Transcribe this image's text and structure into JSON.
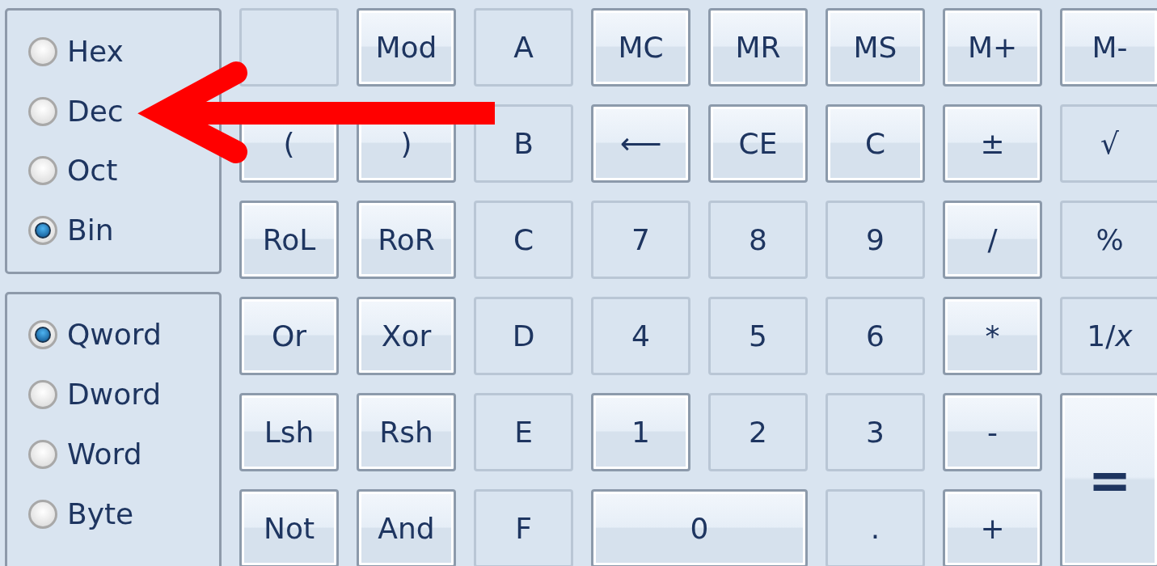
{
  "radix": [
    {
      "label": "Hex",
      "selected": false
    },
    {
      "label": "Dec",
      "selected": false
    },
    {
      "label": "Oct",
      "selected": false
    },
    {
      "label": "Bin",
      "selected": true
    }
  ],
  "word_size": [
    {
      "label": "Qword",
      "selected": true
    },
    {
      "label": "Dword",
      "selected": false
    },
    {
      "label": "Word",
      "selected": false
    },
    {
      "label": "Byte",
      "selected": false
    }
  ],
  "keys": [
    {
      "kind": "blank",
      "disabled": true
    },
    {
      "kind": "normal",
      "label": "Mod",
      "disabled": false
    },
    {
      "kind": "normal",
      "label": "A",
      "disabled": true
    },
    {
      "kind": "normal",
      "label": "MC",
      "disabled": false
    },
    {
      "kind": "normal",
      "label": "MR",
      "disabled": false
    },
    {
      "kind": "normal",
      "label": "MS",
      "disabled": false
    },
    {
      "kind": "normal",
      "label": "M+",
      "disabled": false
    },
    {
      "kind": "normal",
      "label": "M-",
      "disabled": false
    },
    {
      "kind": "normal",
      "label": "(",
      "disabled": false
    },
    {
      "kind": "normal",
      "label": ")",
      "disabled": false
    },
    {
      "kind": "normal",
      "label": "B",
      "disabled": true
    },
    {
      "kind": "normal",
      "label": "⟵",
      "disabled": false
    },
    {
      "kind": "normal",
      "label": "CE",
      "disabled": false
    },
    {
      "kind": "normal",
      "label": "C",
      "disabled": false
    },
    {
      "kind": "normal",
      "label": "±",
      "disabled": false
    },
    {
      "kind": "normal",
      "label": "√",
      "disabled": true
    },
    {
      "kind": "normal",
      "label": "RoL",
      "disabled": false
    },
    {
      "kind": "normal",
      "label": "RoR",
      "disabled": false
    },
    {
      "kind": "normal",
      "label": "C",
      "disabled": true
    },
    {
      "kind": "normal",
      "label": "7",
      "disabled": true
    },
    {
      "kind": "normal",
      "label": "8",
      "disabled": true
    },
    {
      "kind": "normal",
      "label": "9",
      "disabled": true
    },
    {
      "kind": "normal",
      "label": "/",
      "disabled": false
    },
    {
      "kind": "normal",
      "label": "%",
      "disabled": true
    },
    {
      "kind": "normal",
      "label": "Or",
      "disabled": false
    },
    {
      "kind": "normal",
      "label": "Xor",
      "disabled": false
    },
    {
      "kind": "normal",
      "label": "D",
      "disabled": true
    },
    {
      "kind": "normal",
      "label": "4",
      "disabled": true
    },
    {
      "kind": "normal",
      "label": "5",
      "disabled": true
    },
    {
      "kind": "normal",
      "label": "6",
      "disabled": true
    },
    {
      "kind": "normal",
      "label": "*",
      "disabled": false
    },
    {
      "kind": "normal",
      "label": "1/*x*",
      "disabled": true
    },
    {
      "kind": "normal",
      "label": "Lsh",
      "disabled": false
    },
    {
      "kind": "normal",
      "label": "Rsh",
      "disabled": false
    },
    {
      "kind": "normal",
      "label": "E",
      "disabled": true
    },
    {
      "kind": "normal",
      "label": "1",
      "disabled": false
    },
    {
      "kind": "normal",
      "label": "2",
      "disabled": true
    },
    {
      "kind": "normal",
      "label": "3",
      "disabled": true
    },
    {
      "kind": "normal",
      "label": "-",
      "disabled": false
    },
    {
      "kind": "tall",
      "label": "=",
      "disabled": false
    },
    {
      "kind": "normal",
      "label": "Not",
      "disabled": false
    },
    {
      "kind": "normal",
      "label": "And",
      "disabled": false
    },
    {
      "kind": "normal",
      "label": "F",
      "disabled": true
    },
    {
      "kind": "wide",
      "label": "0",
      "disabled": false
    },
    {
      "kind": "normal",
      "label": ".",
      "disabled": true
    },
    {
      "kind": "normal",
      "label": "+",
      "disabled": false
    }
  ]
}
